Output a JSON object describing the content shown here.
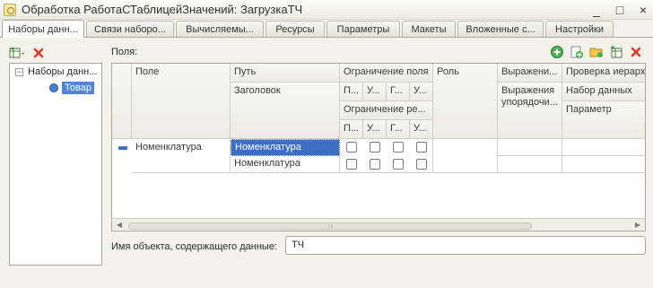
{
  "window": {
    "title": "Обработка РаботаСТаблицейЗначений: ЗагрузкаТЧ",
    "minimize": "_",
    "maximize": "□",
    "close": "×"
  },
  "tabs": [
    "Наборы данн...",
    "Связи наборо...",
    "Вычисляемы...",
    "Ресурсы",
    "Параметры",
    "Макеты",
    "Вложенные с...",
    "Настройки"
  ],
  "tree": {
    "root": "Наборы данн...",
    "child": "Товар",
    "toggle": "⊖"
  },
  "fields_label": "Поля:",
  "grid": {
    "headers": {
      "pole": "Поле",
      "put": "Путь",
      "zagolovok": "Заголовок",
      "ogr_polya": "Ограничение поля",
      "ogr_p": "П...",
      "ogr_u": "У...",
      "ogr_g": "Г...",
      "ogr_u2": "У...",
      "ogr_rekv": "Ограничение ре...",
      "ogr2_p": "П...",
      "ogr2_u": "У...",
      "ogr2_g": "Г...",
      "ogr2_u2": "У...",
      "rol": "Роль",
      "vyrazh": "Выражени...",
      "vyrazh_upor": "Выражения упорядочи...",
      "proverka": "Проверка иерархии",
      "nabor": "Набор данных",
      "parametr": "Параметр"
    },
    "row": {
      "pole": "Номенклатура",
      "put": "Номенклатура",
      "zagolovok": "Номенклатура"
    }
  },
  "object_label": "Имя объекта, содержащего данные:",
  "object_value": "ТЧ"
}
